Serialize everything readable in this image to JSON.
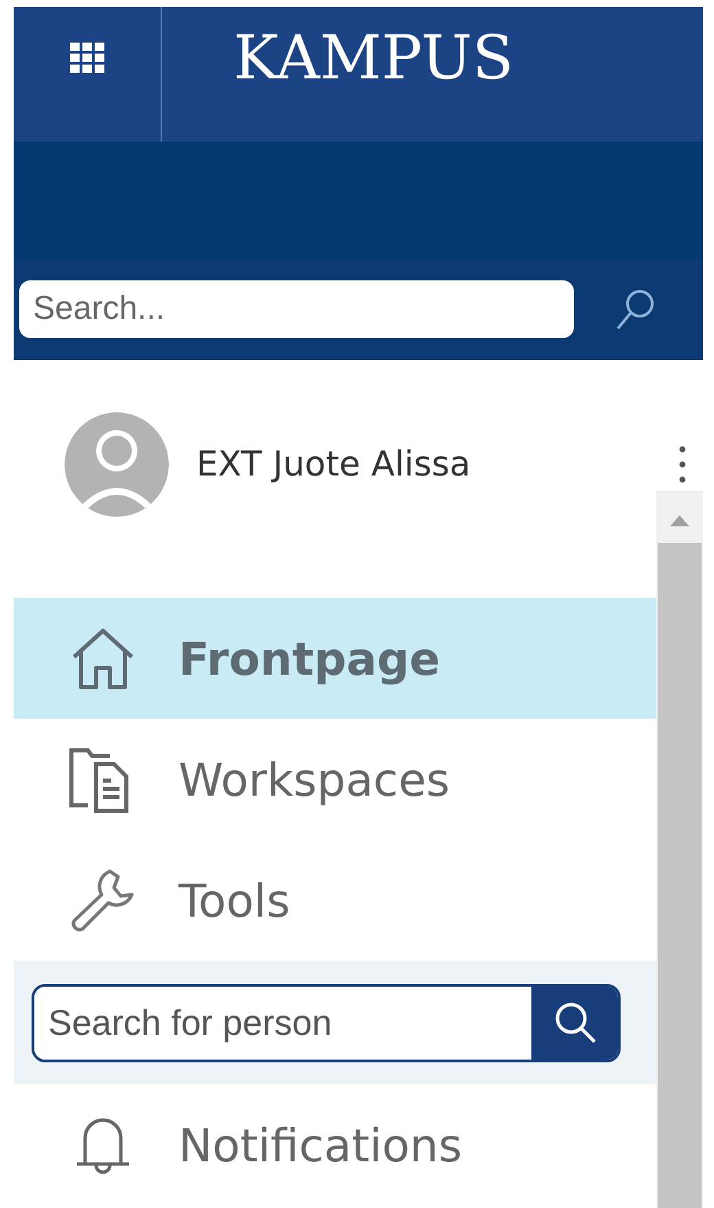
{
  "header": {
    "logo": "KAMPUS"
  },
  "search": {
    "placeholder": "Search..."
  },
  "user": {
    "name": "EXT Juote Alissa"
  },
  "menu": [
    {
      "kind": "nav",
      "label": "Frontpage",
      "selected": true
    },
    {
      "kind": "nav",
      "label": "Workspaces",
      "selected": false
    },
    {
      "kind": "nav",
      "label": "Tools",
      "selected": false
    },
    {
      "kind": "search",
      "placeholder": "Search for person"
    },
    {
      "kind": "nav",
      "label": "Notifications",
      "selected": false
    }
  ]
}
